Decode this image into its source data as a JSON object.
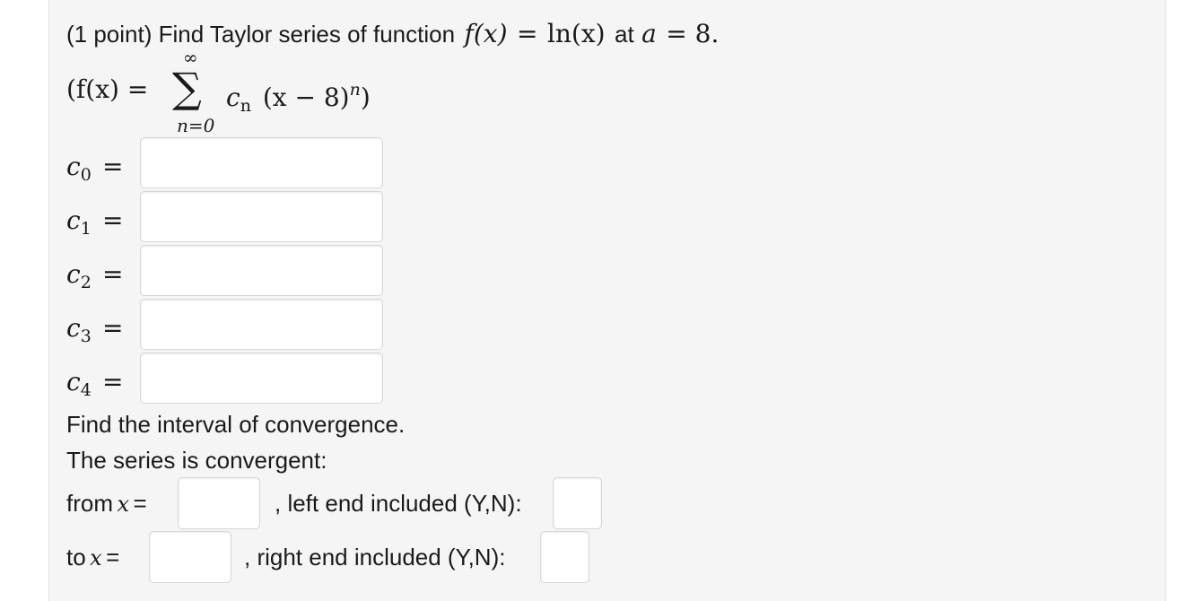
{
  "problem": {
    "prefix": "(1 point) Find Taylor series of function",
    "f_expr": "f(x)",
    "eq": "=",
    "ln_expr": "ln(x)",
    "at_word": "at",
    "a_var": "a",
    "a_eq": "= 8."
  },
  "series_formula": {
    "open": "(f(x) =",
    "sum_symbol": "∑",
    "upper": "∞",
    "lower": "n=0",
    "term_c": "c",
    "term_c_sub": "n",
    "term_paren": "(x − 8)",
    "term_exp": "n",
    "close": ")"
  },
  "coefficients": [
    {
      "var": "c",
      "sub": "0",
      "eq": "=",
      "value": ""
    },
    {
      "var": "c",
      "sub": "1",
      "eq": "=",
      "value": ""
    },
    {
      "var": "c",
      "sub": "2",
      "eq": "=",
      "value": ""
    },
    {
      "var": "c",
      "sub": "3",
      "eq": "=",
      "value": ""
    },
    {
      "var": "c",
      "sub": "4",
      "eq": "=",
      "value": ""
    }
  ],
  "interval": {
    "heading": "Find the interval of convergence.",
    "convergent_text": "The series is convergent:",
    "from_label": "from",
    "to_label": "to",
    "x_var": "x",
    "x_eq": "=",
    "left_included_label": ", left end included (Y,N):",
    "right_included_label": ", right end included (Y,N):",
    "from_value": "",
    "to_value": "",
    "left_included_value": "",
    "right_included_value": ""
  }
}
